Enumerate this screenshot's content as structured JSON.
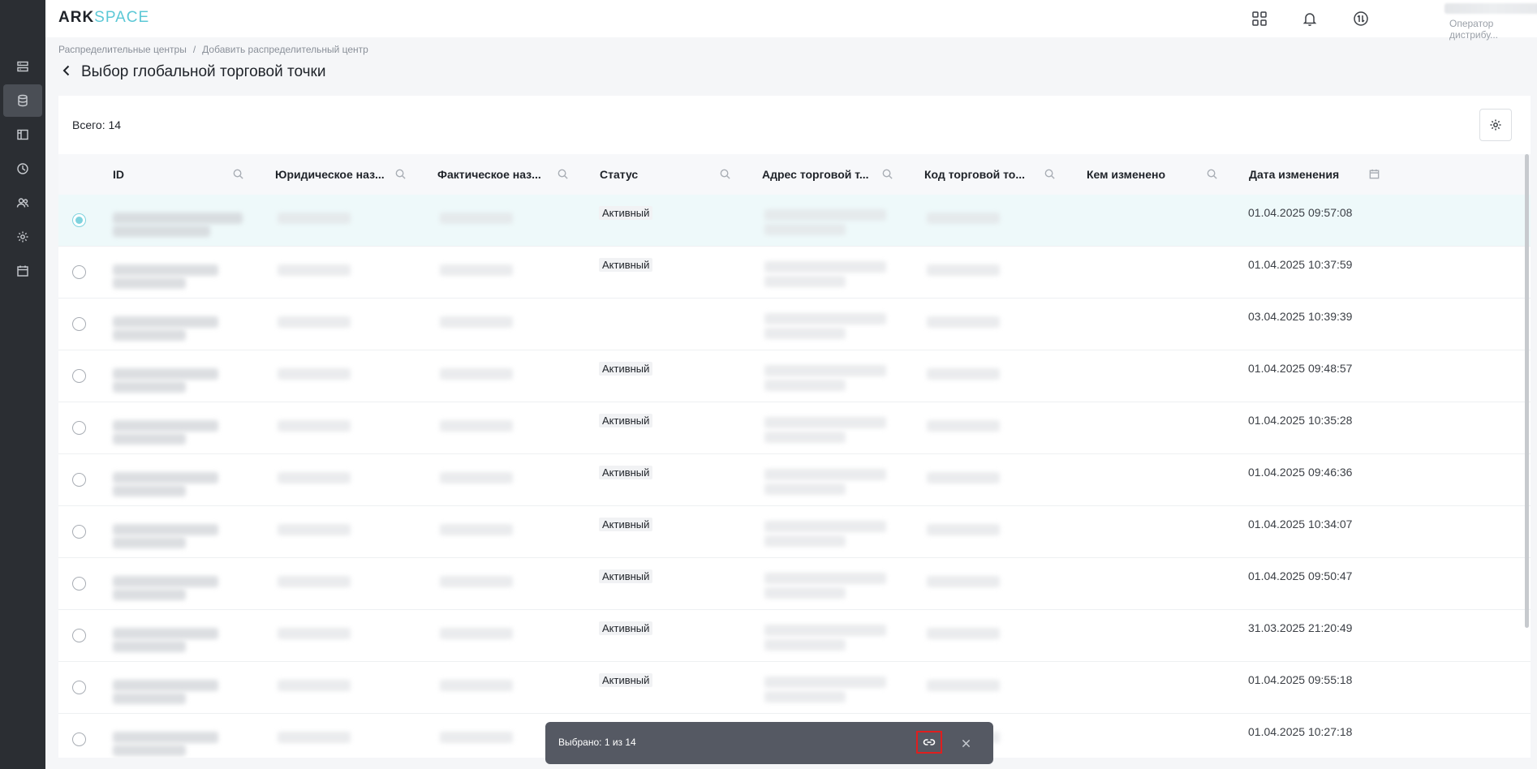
{
  "app": {
    "logo_part1": "ARK",
    "logo_part2": "SPACE"
  },
  "rail": {
    "items": [
      {
        "icon": "server-list-icon",
        "active": false
      },
      {
        "icon": "database-icon",
        "active": true
      },
      {
        "icon": "layout-panel-icon",
        "active": false
      },
      {
        "icon": "pie-clock-icon",
        "active": false
      },
      {
        "icon": "users-icon",
        "active": false
      },
      {
        "icon": "gear-icon",
        "active": false
      },
      {
        "icon": "calendar-icon",
        "active": false
      }
    ]
  },
  "header": {
    "user_role": "Оператор дистрибу..."
  },
  "breadcrumb": {
    "item1": "Распределительные центры",
    "separator": "/",
    "item2": "Добавить распределительный центр"
  },
  "page": {
    "title": "Выбор глобальной торговой точки"
  },
  "table": {
    "total_label": "Всего: 14",
    "columns": [
      {
        "label": "ID",
        "filter_icon": "search-icon"
      },
      {
        "label": "Юридическое наз...",
        "filter_icon": "search-icon"
      },
      {
        "label": "Фактическое наз...",
        "filter_icon": "search-icon"
      },
      {
        "label": "Статус",
        "filter_icon": "search-icon"
      },
      {
        "label": "Адрес торговой т...",
        "filter_icon": "search-icon"
      },
      {
        "label": "Код торговой то...",
        "filter_icon": "search-icon"
      },
      {
        "label": "Кем изменено",
        "filter_icon": "search-icon"
      },
      {
        "label": "Дата изменения",
        "filter_icon": "calendar-icon"
      }
    ],
    "rows": [
      {
        "selected": true,
        "status": "Активный",
        "date": "01.04.2025 09:57:08"
      },
      {
        "selected": false,
        "status": "Активный",
        "date": "01.04.2025 10:37:59"
      },
      {
        "selected": false,
        "status": "",
        "date": "03.04.2025 10:39:39"
      },
      {
        "selected": false,
        "status": "Активный",
        "date": "01.04.2025 09:48:57"
      },
      {
        "selected": false,
        "status": "Активный",
        "date": "01.04.2025 10:35:28"
      },
      {
        "selected": false,
        "status": "Активный",
        "date": "01.04.2025 09:46:36"
      },
      {
        "selected": false,
        "status": "Активный",
        "date": "01.04.2025 10:34:07"
      },
      {
        "selected": false,
        "status": "Активный",
        "date": "01.04.2025 09:50:47"
      },
      {
        "selected": false,
        "status": "Активный",
        "date": "31.03.2025 21:20:49"
      },
      {
        "selected": false,
        "status": "Активный",
        "date": "01.04.2025 09:55:18"
      },
      {
        "selected": false,
        "status": "",
        "date": "01.04.2025 10:27:18"
      }
    ]
  },
  "selection_bar": {
    "text": "Выбрано: 1 из 14",
    "action_icon": "link-icon",
    "close_icon": "close-icon"
  },
  "colors": {
    "accent": "#5cc8d6",
    "rail_bg": "#2b2e33",
    "selection_bar_bg": "#555963",
    "highlight_border": "#e01e1e"
  }
}
